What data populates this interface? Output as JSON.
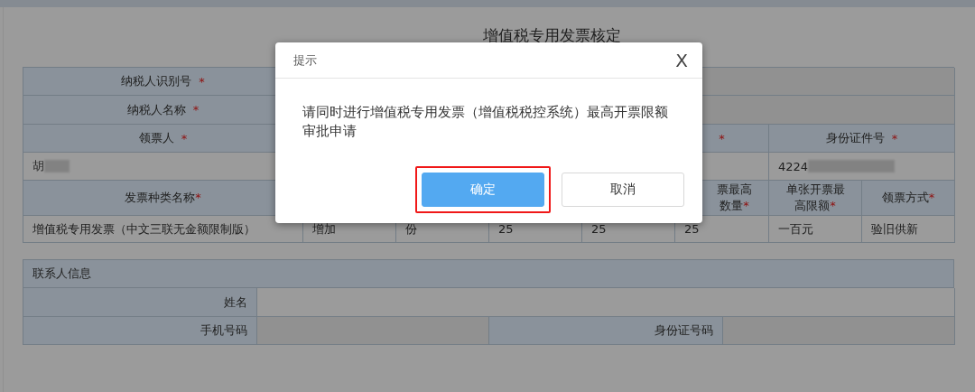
{
  "page": {
    "title": "增值税专用发票核定"
  },
  "invoice_table": {
    "rows": [
      {
        "kind": "label-field",
        "label": "纳税人识别号",
        "mark": "*"
      },
      {
        "kind": "label-field",
        "label": "纳税人名称",
        "mark": "*"
      },
      {
        "kind": "split-head",
        "cells": [
          {
            "label": "领票人",
            "mark": "*"
          },
          {
            "mark": "*"
          },
          {
            "label": "身份证件号",
            "mark": "*"
          }
        ]
      },
      {
        "kind": "split-value",
        "cells": [
          {
            "value": "胡",
            "redacted": true
          },
          {
            "value": "4224",
            "redacted": true
          }
        ]
      },
      {
        "kind": "grid-head",
        "cells": [
          {
            "label": "发票种类名称",
            "mark": "*"
          },
          {
            "label": "票最高数量",
            "mark": "*"
          },
          {
            "label": "单张开票最高限额",
            "mark": "*"
          },
          {
            "label": "领票方式",
            "mark": "*"
          }
        ]
      },
      {
        "kind": "grid-value",
        "cells": [
          {
            "value": "增值税专用发票（中文三联无金额限制版）"
          },
          {
            "value": "增加"
          },
          {
            "value": "份"
          },
          {
            "value": "25"
          },
          {
            "value": "25"
          },
          {
            "value": "25"
          },
          {
            "value": "一百元"
          },
          {
            "value": "验旧供新"
          }
        ]
      }
    ]
  },
  "contact": {
    "title": "联系人信息",
    "rows": [
      {
        "kind": "full",
        "cells": [
          {
            "label": "姓名"
          }
        ]
      },
      {
        "kind": "pair",
        "cells": [
          {
            "label": "手机号码"
          },
          {
            "label": "身份证号码"
          }
        ]
      }
    ]
  },
  "dialog": {
    "title": "提示",
    "close": "X",
    "message": "请同时进行增值税专用发票（增值税税控系统）最高开票限额审批申请",
    "buttons": [
      {
        "label": "确定",
        "kind": "primary",
        "highlighted": true
      },
      {
        "label": "取消",
        "kind": "default",
        "highlighted": false
      }
    ]
  }
}
